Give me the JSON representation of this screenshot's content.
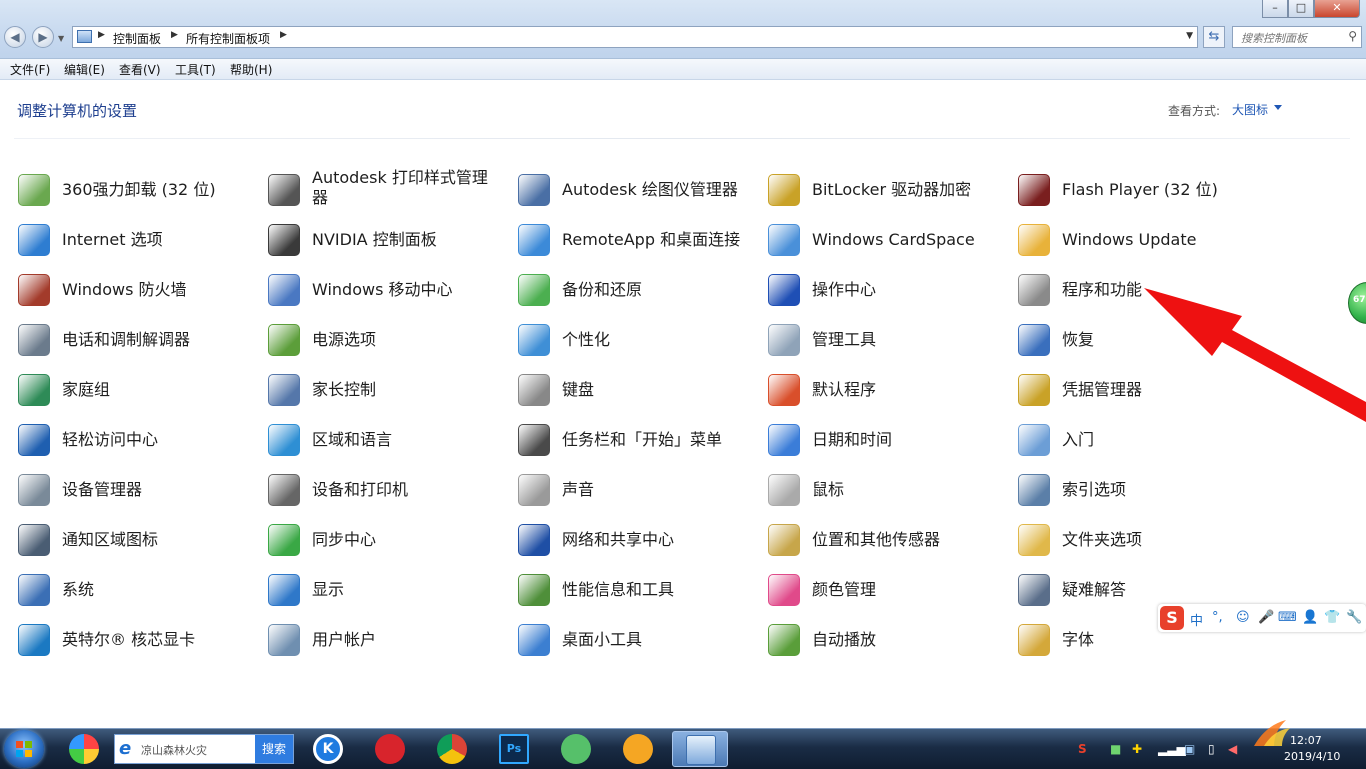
{
  "window": {
    "minimize": "–",
    "maximize": "□",
    "close": "✕"
  },
  "nav": {
    "back": "◀",
    "forward": "▶"
  },
  "address": {
    "crumbs": [
      "控制面板",
      "所有控制面板项"
    ]
  },
  "search": {
    "placeholder": "搜索控制面板"
  },
  "menu": [
    "文件(F)",
    "编辑(E)",
    "查看(V)",
    "工具(T)",
    "帮助(H)"
  ],
  "header": {
    "title": "调整计算机的设置",
    "view_label": "查看方式:",
    "view_value": "大图标"
  },
  "items": [
    [
      "360强力卸载 (32 位)",
      "Autodesk 打印样式管理器",
      "Autodesk 绘图仪管理器",
      "BitLocker 驱动器加密",
      "Flash Player (32 位)"
    ],
    [
      "Internet 选项",
      "NVIDIA 控制面板",
      "RemoteApp 和桌面连接",
      "Windows CardSpace",
      "Windows Update"
    ],
    [
      "Windows 防火墙",
      "Windows 移动中心",
      "备份和还原",
      "操作中心",
      "程序和功能"
    ],
    [
      "电话和调制解调器",
      "电源选项",
      "个性化",
      "管理工具",
      "恢复"
    ],
    [
      "家庭组",
      "家长控制",
      "键盘",
      "默认程序",
      "凭据管理器"
    ],
    [
      "轻松访问中心",
      "区域和语言",
      "任务栏和「开始」菜单",
      "日期和时间",
      "入门"
    ],
    [
      "设备管理器",
      "设备和打印机",
      "声音",
      "鼠标",
      "索引选项"
    ],
    [
      "通知区域图标",
      "同步中心",
      "网络和共享中心",
      "位置和其他传感器",
      "文件夹选项"
    ],
    [
      "系统",
      "显示",
      "性能信息和工具",
      "颜色管理",
      "疑难解答"
    ],
    [
      "英特尔® 核芯显卡",
      "用户帐户",
      "桌面小工具",
      "自动播放",
      "字体"
    ]
  ],
  "icon_colors": [
    [
      "#6aa84f",
      "#555555",
      "#4a6fa5",
      "#c9a227",
      "#7a1f1f"
    ],
    [
      "#2e7dd1",
      "#3a3a3a",
      "#3c8ad8",
      "#4a90d9",
      "#e8b23a"
    ],
    [
      "#a33b2b",
      "#4a78c2",
      "#4caf50",
      "#1f4fb5",
      "#8a8a8a"
    ],
    [
      "#6b7b8c",
      "#5c9e3a",
      "#3f8fd6",
      "#8fa3b8",
      "#3a6fbd"
    ],
    [
      "#2e8b57",
      "#5577aa",
      "#888888",
      "#d94f2b",
      "#c9a227"
    ],
    [
      "#1f5fb0",
      "#2e8fd4",
      "#4a4a4a",
      "#3b7dd8",
      "#6c9ed6"
    ],
    [
      "#7a8a99",
      "#666666",
      "#9a9a9a",
      "#aaaaaa",
      "#5b7fa8"
    ],
    [
      "#4a5d73",
      "#3aa845",
      "#1f4fa5",
      "#c7a64a",
      "#e0b84a"
    ],
    [
      "#3b6fb5",
      "#2f78c9",
      "#4f8f3a",
      "#e04a8a",
      "#5a6e8a"
    ],
    [
      "#1b79c2",
      "#6f8fb0",
      "#3c7fd1",
      "#5a9e3a",
      "#d4a83a"
    ]
  ],
  "side_ball": {
    "text": "67"
  },
  "ime": {
    "items": [
      "中",
      "°,",
      "☺",
      "🎤",
      "⌨",
      "👤",
      "👕",
      "🔧"
    ]
  },
  "taskbar": {
    "search_value": "凉山森林火灾",
    "search_button": "搜索"
  },
  "tray": {
    "time": "12:07",
    "date": "2019/4/10"
  }
}
